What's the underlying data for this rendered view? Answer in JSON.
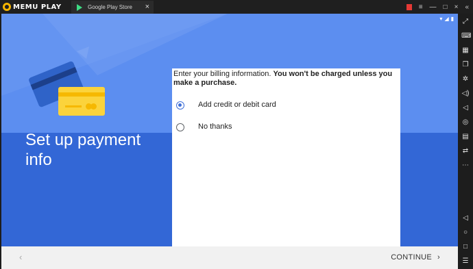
{
  "app": {
    "brand": "MEMU PLAY",
    "tab_title": "Google Play Store",
    "tab_close": "×",
    "window_controls": [
      "≡",
      "—",
      "□",
      "×"
    ],
    "collapse": "«"
  },
  "status_bar": {
    "wifi": "▾",
    "signal": "◢",
    "battery": "▮"
  },
  "page": {
    "title_line1": "Set up payment",
    "title_line2": "info"
  },
  "billing": {
    "prompt_normal": "Enter your billing information. ",
    "prompt_bold": "You won't be charged unless you make a purchase.",
    "options": [
      {
        "label": "Add credit or debit card",
        "selected": true
      },
      {
        "label": "No thanks",
        "selected": false
      }
    ]
  },
  "footer": {
    "back": "‹",
    "continue_label": "CONTINUE",
    "continue_chevron": "›"
  },
  "sidebar": {
    "icons": [
      "fullscreen-icon",
      "keyboard-icon",
      "calendar-icon",
      "window-icon",
      "settings-icon",
      "volume-up-icon",
      "volume-down-icon",
      "location-icon",
      "folder-icon",
      "sync-icon",
      "more-icon",
      "back-icon",
      "home-icon",
      "recents-icon",
      "menu-icon"
    ]
  },
  "colors": {
    "background_blue": "#3367d6",
    "light_band_blue": "#5c8ef0",
    "card_yellow": "#fbd33c",
    "radio_blue": "#3f6fd8"
  }
}
